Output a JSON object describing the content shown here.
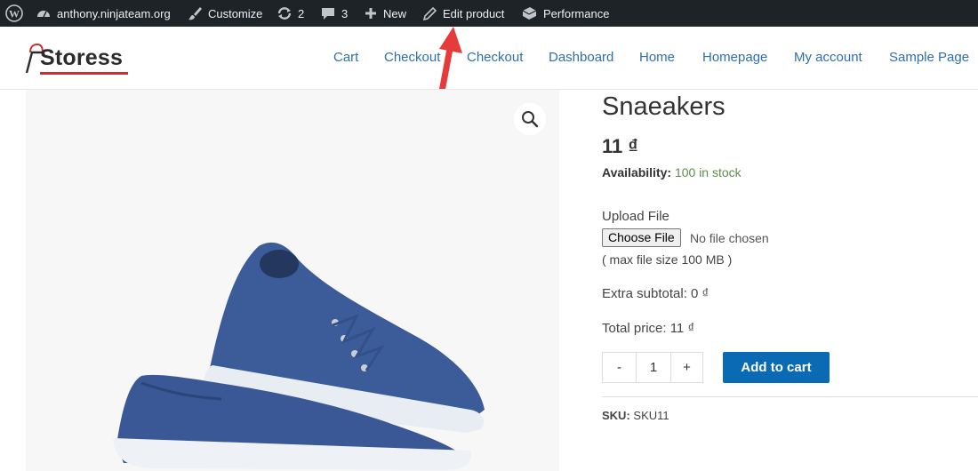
{
  "adminbar": {
    "site_name": "anthony.ninjateam.org",
    "customize": "Customize",
    "updates_count": "2",
    "comments_count": "3",
    "new_label": "New",
    "edit_product": "Edit product",
    "performance": "Performance"
  },
  "header": {
    "logo_text": "Storess",
    "nav": [
      "Cart",
      "Checkout",
      "Checkout",
      "Dashboard",
      "Home",
      "Homepage",
      "My account",
      "Sample Page"
    ]
  },
  "product": {
    "title": "Snaeakers",
    "price": "11 ₫",
    "availability_label": "Availability:",
    "availability_value": "100 in stock",
    "upload_label": "Upload File",
    "choose_file": "Choose File",
    "no_file": "No file chosen",
    "max_size": "( max file size 100 MB )",
    "extra_subtotal": "Extra subtotal:  0 ₫",
    "total_price": "Total price:  11 ₫",
    "qty_minus": "-",
    "qty_value": "1",
    "qty_plus": "+",
    "add_to_cart": "Add to cart",
    "sku_label": "SKU:",
    "sku_value": "SKU11"
  },
  "colors": {
    "adminbar_bg": "#1d2327",
    "link": "#2f6fad",
    "button": "#0b6ab4",
    "in_stock": "#5b8f4a",
    "arrow": "#e63b3b"
  }
}
